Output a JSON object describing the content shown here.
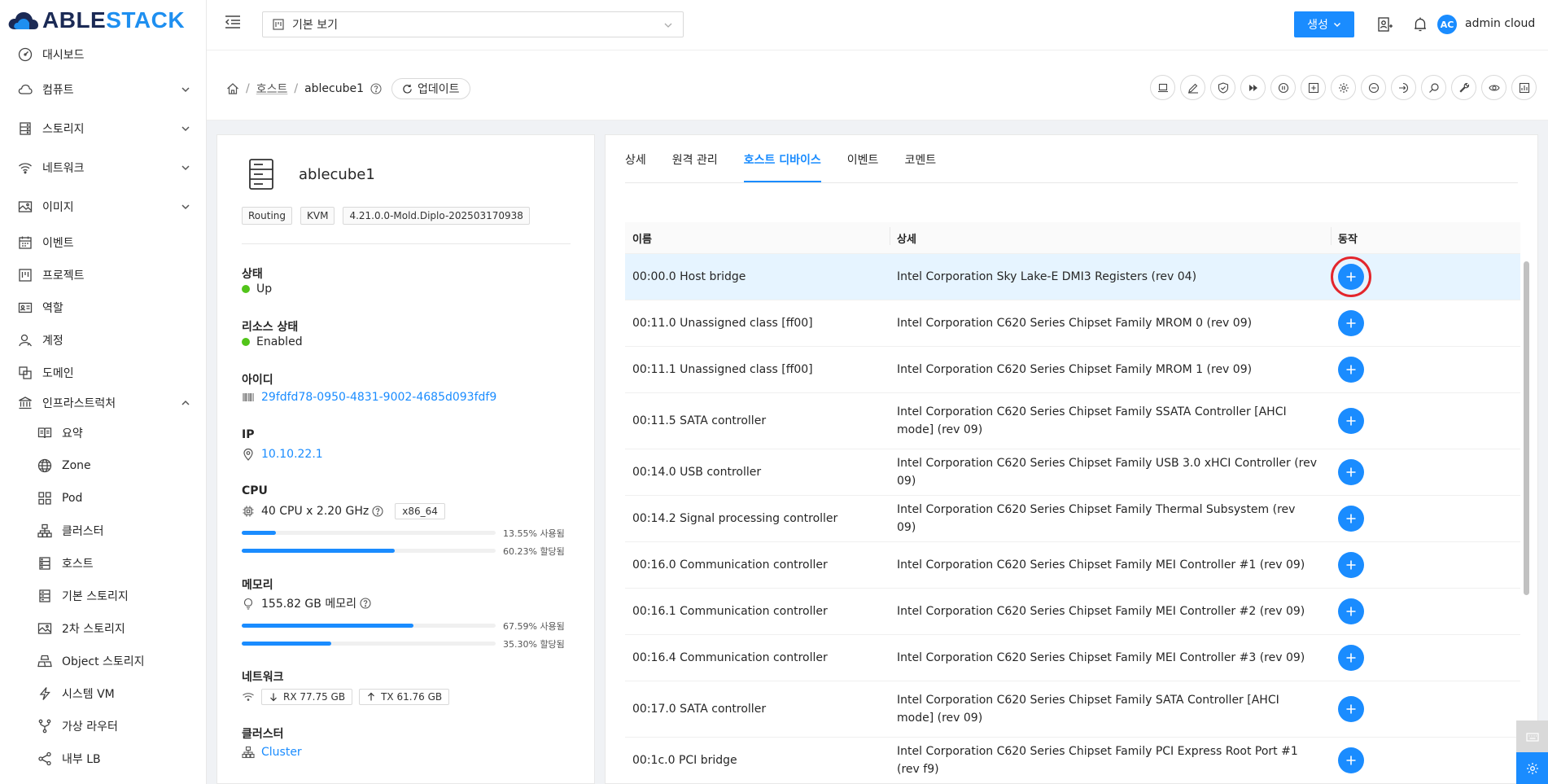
{
  "app": {
    "logo_part1": "ABLE",
    "logo_part2": "STACK"
  },
  "colors": {
    "primary": "#1a8cff",
    "success": "#52c41a",
    "highlight": "#e3262c",
    "logo_dark": "#1b2a55"
  },
  "sidebar": {
    "items": [
      {
        "label": "대시보드",
        "icon": "dashboard-icon"
      },
      {
        "label": "컴퓨트",
        "icon": "cloud-icon",
        "chevron": "down"
      },
      {
        "label": "스토리지",
        "icon": "storage-icon",
        "chevron": "down"
      },
      {
        "label": "네트워크",
        "icon": "wifi-icon",
        "chevron": "down"
      },
      {
        "label": "이미지",
        "icon": "image-icon",
        "chevron": "down"
      },
      {
        "label": "이벤트",
        "icon": "calendar-icon"
      },
      {
        "label": "프로젝트",
        "icon": "project-icon"
      },
      {
        "label": "역할",
        "icon": "idcard-icon"
      },
      {
        "label": "계정",
        "icon": "user-icon"
      },
      {
        "label": "도메인",
        "icon": "block-icon"
      },
      {
        "label": "인프라스트럭처",
        "icon": "bank-icon",
        "chevron": "up"
      }
    ],
    "subitems": [
      {
        "label": "요약",
        "icon": "read-icon"
      },
      {
        "label": "Zone",
        "icon": "globe-icon"
      },
      {
        "label": "Pod",
        "icon": "appstore-icon"
      },
      {
        "label": "클러스터",
        "icon": "cluster-icon"
      },
      {
        "label": "호스트",
        "icon": "database-icon"
      },
      {
        "label": "기본 스토리지",
        "icon": "hdd-icon"
      },
      {
        "label": "2차 스토리지",
        "icon": "picture-icon"
      },
      {
        "label": "Object 스토리지",
        "icon": "gold-icon"
      },
      {
        "label": "시스템 VM",
        "icon": "thunderbolt-icon"
      },
      {
        "label": "가상 라우터",
        "icon": "fork-icon"
      },
      {
        "label": "내부 LB",
        "icon": "share-icon"
      }
    ]
  },
  "header": {
    "view_select": "기본 보기",
    "create_label": "생성",
    "avatar_initials": "AC",
    "username": "admin cloud"
  },
  "breadcrumb": {
    "section": "호스트",
    "current": "ablecube1",
    "refresh_label": "업데이트"
  },
  "host": {
    "name": "ablecube1",
    "tags": [
      "Routing",
      "KVM",
      "4.21.0.0-Mold.Diplo-202503170938"
    ],
    "state_label": "상태",
    "state_value": "Up",
    "resource_state_label": "리소스 상태",
    "resource_state_value": "Enabled",
    "id_label": "아이디",
    "id_value": "29fdfd78-0950-4831-9002-4685d093fdf9",
    "ip_label": "IP",
    "ip_value": "10.10.22.1",
    "cpu_label": "CPU",
    "cpu_value": "40 CPU x 2.20 GHz",
    "cpu_arch": "x86_64",
    "cpu_used": "13.55% 사용됨",
    "cpu_used_pct": 13.55,
    "cpu_alloc": "60.23% 할당됨",
    "cpu_alloc_pct": 60.23,
    "mem_label": "메모리",
    "mem_value": "155.82 GB 메모리",
    "mem_used": "67.59% 사용됨",
    "mem_used_pct": 67.59,
    "mem_alloc": "35.30% 할당됨",
    "mem_alloc_pct": 35.3,
    "net_label": "네트워크",
    "net_rx": "RX 77.75 GB",
    "net_tx": "TX 61.76 GB",
    "cluster_label": "클러스터",
    "cluster_value": "Cluster"
  },
  "tabs": [
    "상세",
    "원격 관리",
    "호스트 디바이스",
    "이벤트",
    "코멘트"
  ],
  "active_tab": "호스트 디바이스",
  "table": {
    "headers": [
      "이름",
      "상세",
      "동작"
    ],
    "rows": [
      {
        "name": "00:00.0 Host bridge",
        "detail": "Intel Corporation Sky Lake-E DMI3 Registers (rev 04)"
      },
      {
        "name": "00:11.0 Unassigned class [ff00]",
        "detail": "Intel Corporation C620 Series Chipset Family MROM 0 (rev 09)"
      },
      {
        "name": "00:11.1 Unassigned class [ff00]",
        "detail": "Intel Corporation C620 Series Chipset Family MROM 1 (rev 09)"
      },
      {
        "name": "00:11.5 SATA controller",
        "detail": "Intel Corporation C620 Series Chipset Family SSATA Controller [AHCI mode] (rev 09)"
      },
      {
        "name": "00:14.0 USB controller",
        "detail": "Intel Corporation C620 Series Chipset Family USB 3.0 xHCI Controller (rev 09)"
      },
      {
        "name": "00:14.2 Signal processing controller",
        "detail": "Intel Corporation C620 Series Chipset Family Thermal Subsystem (rev 09)"
      },
      {
        "name": "00:16.0 Communication controller",
        "detail": "Intel Corporation C620 Series Chipset Family MEI Controller #1 (rev 09)"
      },
      {
        "name": "00:16.1 Communication controller",
        "detail": "Intel Corporation C620 Series Chipset Family MEI Controller #2 (rev 09)"
      },
      {
        "name": "00:16.4 Communication controller",
        "detail": "Intel Corporation C620 Series Chipset Family MEI Controller #3 (rev 09)"
      },
      {
        "name": "00:17.0 SATA controller",
        "detail": "Intel Corporation C620 Series Chipset Family SATA Controller [AHCI mode] (rev 09)"
      },
      {
        "name": "00:1c.0 PCI bridge",
        "detail": "Intel Corporation C620 Series Chipset Family PCI Express Root Port #1 (rev f9)"
      }
    ]
  }
}
